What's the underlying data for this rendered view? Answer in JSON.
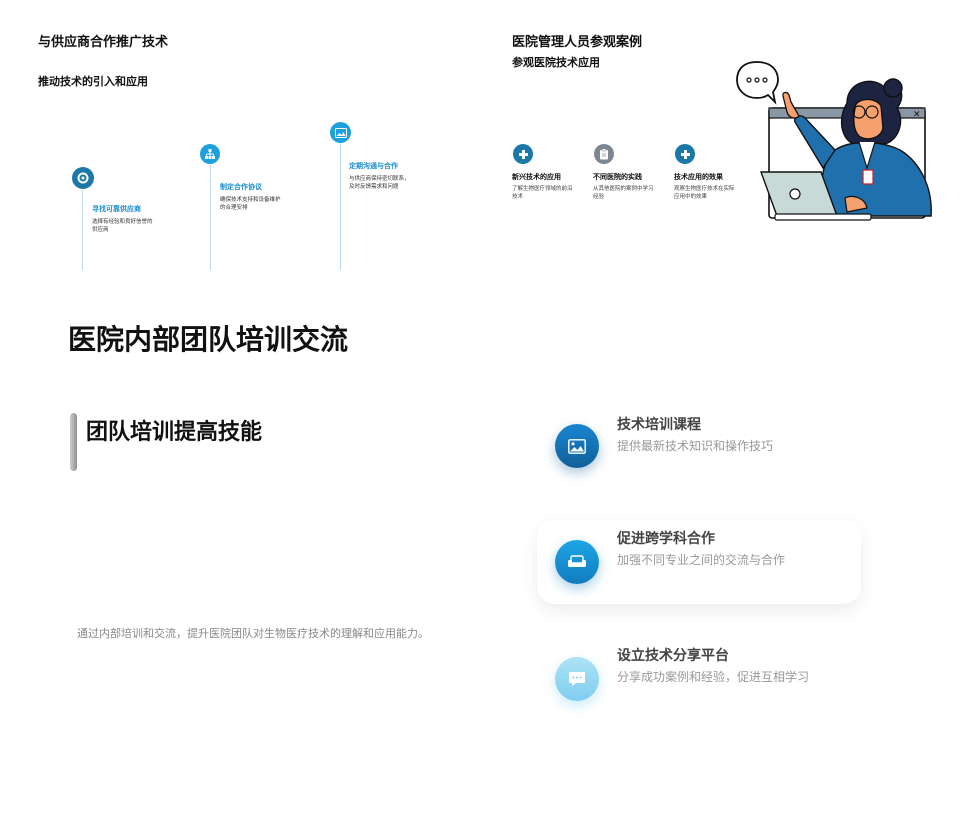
{
  "top_left": {
    "title": "与供应商合作推广技术",
    "subtitle": "推动技术的引入和应用",
    "steps": [
      {
        "title": "寻找可靠供应商",
        "desc": "选择有经验和良好信誉的供应商",
        "icon": "target-icon"
      },
      {
        "title": "制定合作协议",
        "desc": "确保技术支持和设备维护的合理安排",
        "icon": "org-chart-icon"
      },
      {
        "title": "定期沟通与合作",
        "desc": "与供应商保持密切联系，及时反馈需求和问题",
        "icon": "image-icon"
      }
    ]
  },
  "top_right": {
    "title": "医院管理人员参观案例",
    "subtitle": "参观医院技术应用",
    "steps": [
      {
        "title": "新兴技术的应用",
        "desc": "了解生物医疗领域的前沿技术",
        "icon": "medical-cross-icon"
      },
      {
        "title": "不同医院的实践",
        "desc": "从其他医院的案例中学习经验",
        "icon": "clipboard-icon"
      },
      {
        "title": "技术应用的效果",
        "desc": "观察生物医疗技术在实际应用中的效果",
        "icon": "medical-cross-icon"
      }
    ]
  },
  "main": {
    "title": "医院内部团队培训交流",
    "section_title": "团队培训提高技能",
    "description": "通过内部培训和交流，提升医院团队对生物医疗技术的理解和应用能力。",
    "features": [
      {
        "title": "技术培训课程",
        "desc": "提供最新技术知识和操作技巧",
        "icon": "image-icon"
      },
      {
        "title": "促进跨学科合作",
        "desc": "加强不同专业之间的交流与合作",
        "icon": "sofa-icon"
      },
      {
        "title": "设立技术分享平台",
        "desc": "分享成功案例和经验，促进互相学习",
        "icon": "chat-bubble-icon"
      }
    ]
  },
  "colors": {
    "accent": "#1ea0dd",
    "accent_dark": "#1c78a6",
    "text": "#111111",
    "muted": "#999999"
  }
}
